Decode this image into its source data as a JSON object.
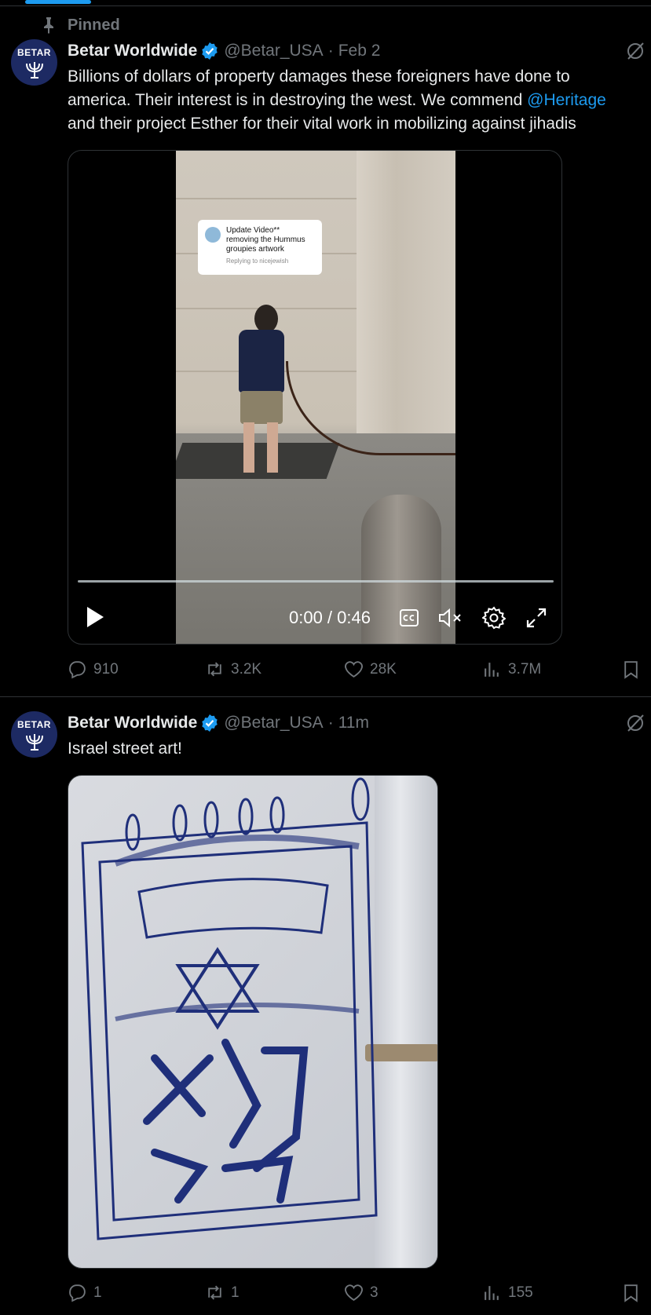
{
  "pinned_label": "Pinned",
  "colors": {
    "accent": "#1d9bf0",
    "muted": "#71767b",
    "text": "#e7e9ea",
    "divider": "#2f3336"
  },
  "tweets": [
    {
      "author": "Betar Worldwide",
      "handle": "@Betar_USA",
      "separator": "·",
      "time": "Feb 2",
      "avatar_text": "BETAR",
      "text_lines": [
        "Billions of dollars of property damages these foreigners have done to",
        "america. Their interest is in destroying the west. We commend ",
        "and their project Esther for their vital work in mobilizing against jihadis"
      ],
      "mention": "@Heritage",
      "media": {
        "type": "video",
        "overlay_text": [
          "Update Video**",
          "removing the Hummus",
          "groupies artwork"
        ],
        "overlay_reply": "Replying to nicejewish",
        "timecode": "0:00 / 0:46",
        "progress": 0
      },
      "stats": {
        "replies": "910",
        "reposts": "3.2K",
        "likes": "28K",
        "views": "3.7M"
      }
    },
    {
      "author": "Betar Worldwide",
      "handle": "@Betar_USA",
      "separator": "·",
      "time": "11m",
      "avatar_text": "BETAR",
      "text_lines": [
        "Israel street art!"
      ],
      "media": {
        "type": "photo"
      },
      "stats": {
        "replies": "1",
        "reposts": "1",
        "likes": "3",
        "views": "155"
      }
    }
  ],
  "icons": [
    "pin-icon",
    "verified-badge-icon",
    "grok-icon",
    "play-icon",
    "captions-icon",
    "mute-icon",
    "settings-icon",
    "fullscreen-icon",
    "reply-icon",
    "repost-icon",
    "like-icon",
    "views-icon",
    "bookmark-icon",
    "menorah-icon",
    "star-of-david-icon"
  ]
}
